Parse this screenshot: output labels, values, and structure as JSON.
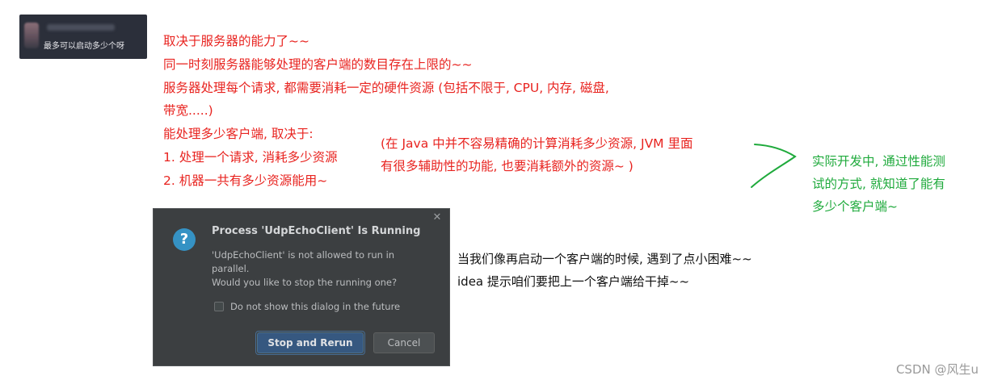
{
  "mini_card": {
    "text": "最多可以启动多少个呀"
  },
  "red_annotations": {
    "lines": [
      "取决于服务器的能力了~~",
      "同一时刻服务器能够处理的客户端的数目存在上限的~~",
      "服务器处理每个请求, 都需要消耗一定的硬件资源 (包括不限于, CPU, 内存, 磁盘,",
      "带宽.....)",
      "能处理多少客户端, 取决于:",
      "1. 处理一个请求, 消耗多少资源",
      "2. 机器一共有多少资源能用~"
    ],
    "note_lines": [
      "(在 Java 中并不容易精确的计算消耗多少资源, JVM 里面",
      "有很多辅助性的功能, 也要消耗额外的资源~ )"
    ],
    "color": "#e8231f"
  },
  "green_annotation": {
    "lines": [
      "实际开发中, 通过性能测",
      "试的方式, 就知道了能有",
      "多少个客户端~"
    ],
    "color": "#1faa3c"
  },
  "dialog": {
    "icon": "question-icon",
    "title": "Process 'UdpEchoClient' Is Running",
    "message_lines": [
      "'UdpEchoClient' is not allowed to run in",
      "parallel.",
      "Would you like to stop the running one?"
    ],
    "checkbox_label": "Do not show this dialog in the future",
    "checkbox_checked": false,
    "primary_button": "Stop and Rerun",
    "secondary_button": "Cancel",
    "close_symbol": "✕"
  },
  "black_annotation": {
    "lines": [
      "当我们像再启动一个客户端的时候, 遇到了点小困难~~",
      "idea 提示咱们要把上一个客户端给干掉~~"
    ]
  },
  "watermark": "CSDN @风生u"
}
